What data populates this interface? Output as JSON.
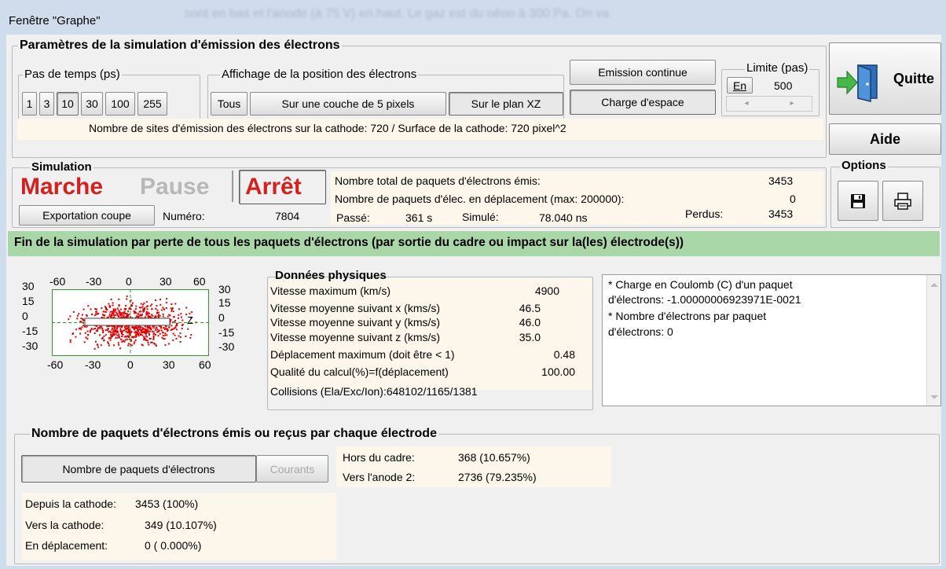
{
  "window": {
    "title": "Fenêtre \"Graphe\"",
    "bg_text": "sont en bas et l'anode (à 75 V) en haut. Le gaz est du néon à 300 Pa. On va"
  },
  "params": {
    "title": "Paramètres de la simulation d'émission des électrons",
    "pas": {
      "title": "Pas de temps (ps)",
      "buttons": [
        "1",
        "3",
        "10",
        "30",
        "100",
        "255"
      ],
      "selected": "10"
    },
    "affichage": {
      "title": "Affichage de la position des électrons",
      "tous": "Tous",
      "couche": "Sur une couche de 5 pixels",
      "plan": "Sur le plan XZ"
    },
    "emission": "Emission continue",
    "charge": "Charge d'espace",
    "limite": {
      "title": "Limite (pas)",
      "en": "En",
      "value": "500",
      "left": "◂",
      "right": "▸"
    },
    "sites": "Nombre de sites d'émission des électrons sur la cathode: 720 / Surface de la cathode: 720 pixel^2"
  },
  "quitte": "Quitte",
  "aide": "Aide",
  "options": {
    "title": "Options",
    "save_icon": "floppy-disk",
    "print_icon": "printer"
  },
  "simulation": {
    "title": "Simulation",
    "marche": "Marche",
    "pause": "Pause",
    "arret": "Arrêt",
    "export": "Exportation coupe",
    "numero_label": "Numéro:",
    "numero": "7804",
    "total_label": "Nombre total de paquets d'électrons émis:",
    "total": "3453",
    "depl_label": "Nombre de paquets d'élec. en déplacement (max: 200000):",
    "depl": "0",
    "perdus_label": "Perdus:",
    "perdus": "3453",
    "passe_label": "Passé:",
    "passe": "361 s",
    "simule_label": "Simulé:",
    "simule": "78.040 ns"
  },
  "status": "Fin de la simulation par perte de tous les paquets d'électrons (par sortie du cadre ou impact sur la(les) électrode(s))",
  "plot": {
    "top_ticks": [
      "-60",
      "-30",
      "0",
      "30",
      "60"
    ],
    "bottom_ticks": [
      "-60",
      "-30",
      "0",
      "30",
      "60"
    ],
    "left_ticks": [
      "30",
      "15",
      "0",
      "-15",
      "-30"
    ],
    "right_ticks": [
      "30",
      "15",
      "0",
      "-15",
      "-30"
    ],
    "z": "Z",
    "colors": {
      "grid": "#2e9a2e",
      "dots": "#e00000"
    }
  },
  "physique": {
    "title": "Données physiques",
    "rows": [
      {
        "label": "Vitesse maximum (km/s)",
        "value": "4900"
      },
      {
        "label": "Vitesse moyenne suivant x (kms/s)",
        "value": "46.5"
      },
      {
        "label": "Vitesse moyenne suivant y (kms/s)",
        "value": "46.0"
      },
      {
        "label": "Vitesse moyenne suivant z (kms/s)",
        "value": "35.0"
      },
      {
        "label": "Déplacement maximum (doit être < 1)",
        "value": "0.48"
      },
      {
        "label": "Qualité du calcul(%)=f(déplacement)",
        "value": "100.00"
      }
    ],
    "collisions": "Collisions (Ela/Exc/Ion):648102/1165/1381"
  },
  "note": {
    "l1": " * Charge en Coulomb (C) d'un paquet",
    "l2": "d'électrons: -1.00000006923971E-0021",
    "l3": " * Nombre d'électrons par paquet",
    "l4": "d'électrons: 0"
  },
  "electrode": {
    "title": "Nombre de paquets d'électrons émis ou reçus par chaque électrode",
    "btn_paquets": "Nombre de paquets d'électrons",
    "btn_courants": "Courants",
    "hors_label": "Hors du cadre:",
    "hors": "368 (10.657%)",
    "anode_label": "Vers l'anode 2:",
    "anode": "2736 (79.235%)",
    "depuis_label": "Depuis la cathode:",
    "depuis": "3453 (100%)",
    "vers_label": "Vers la cathode:",
    "vers": "349 (10.107%)",
    "endep_label": "En déplacement:",
    "endep": "0 ( 0.000%)"
  }
}
